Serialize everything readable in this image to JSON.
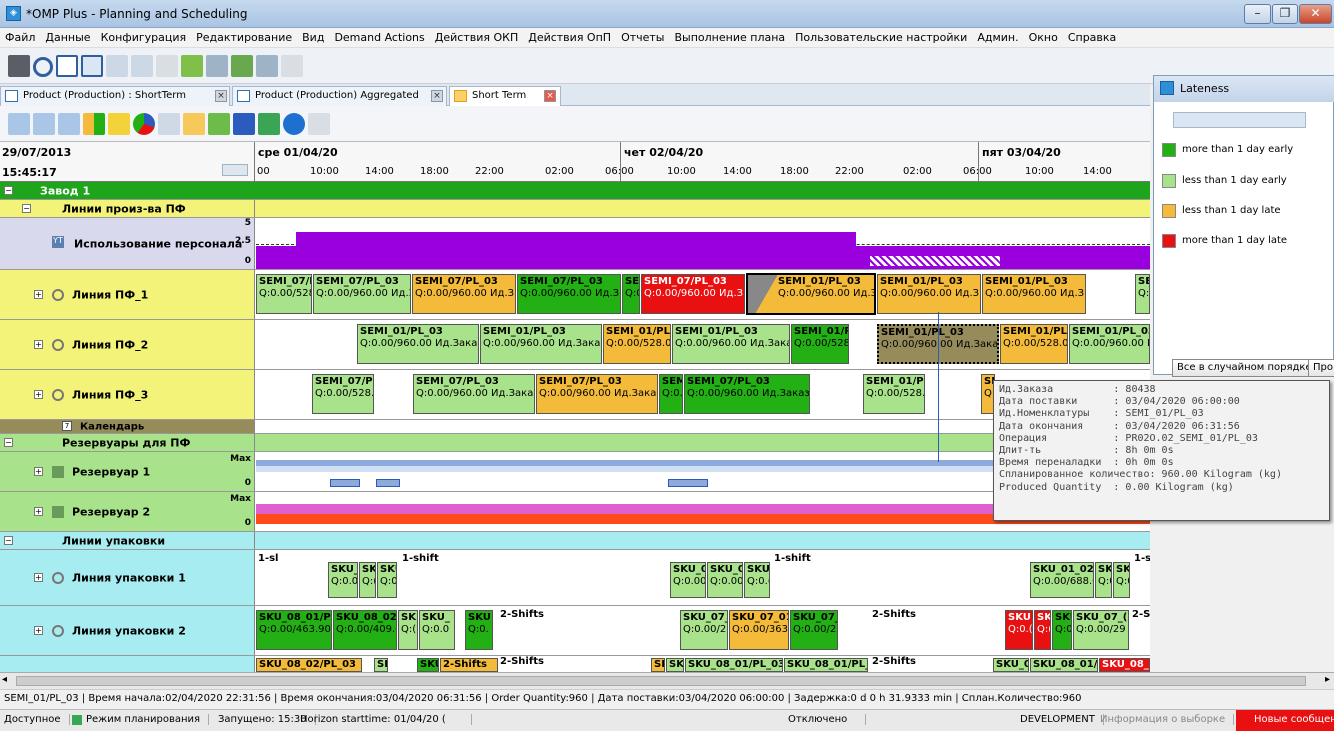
{
  "window": {
    "title": "*OMP Plus - Planning and Scheduling",
    "controls": [
      "–",
      "❐",
      "✕"
    ]
  },
  "menu": [
    "Файл",
    "Данные",
    "Конфигурация",
    "Редактирование",
    "Вид",
    "Demand Actions",
    "Действия ОКП",
    "Действия ОпП",
    "Отчеты",
    "Выполнение плана",
    "Пользовательские настройки",
    "Админ.",
    "Окно",
    "Справка"
  ],
  "tabs": [
    {
      "label": "Product (Production) : ShortTerm"
    },
    {
      "label": "Product (Production) Aggregated"
    },
    {
      "label": "Short Term"
    }
  ],
  "header": {
    "date": "29/07/2013",
    "time": "15:45:17",
    "days": [
      "сре 01/04/20",
      "чет 02/04/20",
      "пят 03/04/20"
    ],
    "hours": [
      "00",
      "10:00",
      "14:00",
      "18:00",
      "22:00",
      "02:00",
      "06:00",
      "10:00",
      "14:00",
      "18:00",
      "22:00",
      "02:00",
      "06:00",
      "10:00",
      "14:00"
    ]
  },
  "rows": {
    "zavod": "Завод 1",
    "lines_group": "Линии произ-ва ПФ",
    "personnel": {
      "label": "Использование персонала",
      "scale_top": "5",
      "scale_mid": "2.5",
      "scale_bot": "0"
    },
    "line1": "Линия ПФ_1",
    "line2": "Линия ПФ_2",
    "line3": "Линия ПФ_3",
    "calendar": "Календарь",
    "reservoirs_group": "Резервуары для ПФ",
    "res1": {
      "label": "Резервуар 1",
      "max": "Max",
      "zero": "0"
    },
    "res2": {
      "label": "Резервуар 2",
      "max": "Max",
      "zero": "0"
    },
    "pack_group": "Линии упаковки",
    "pack1": "Линия упаковки 1",
    "pack2": "Линия упаковки 2"
  },
  "bars": {
    "l1": [
      {
        "t": "SEMI_07/P",
        "q": "Q:0.00/528"
      },
      {
        "t": "SEMI_07/PL_03",
        "q": "Q:0.00/960.00  Ид.З"
      },
      {
        "t": "SEMI_07/PL_03",
        "q": "Q:0.00/960.00  Ид.З"
      },
      {
        "t": "SEMI_07/PL_03",
        "q": "Q:0.00/960.00  Ид.З"
      },
      {
        "t": "SEM",
        "q": "Q:0."
      },
      {
        "t": "SEMI_07/PL_03",
        "q": "Q:0.00/960.00  Ид.З"
      },
      {
        "t": "SEMI_01/PL_03",
        "q": "Q:0.00/960.00  Ид.З"
      },
      {
        "t": "SEMI_01/PL_03",
        "q": "Q:0.00/960.00  Ид.З"
      },
      {
        "t": "SEMI_01/PL_03",
        "q": "Q:0.00/960.00  Ид.З"
      },
      {
        "t": "SE",
        "q": "Q:"
      }
    ],
    "l2": [
      {
        "t": "SEMI_01/PL_03",
        "q": "Q:0.00/960.00  Ид.Заказ"
      },
      {
        "t": "SEMI_01/PL_03",
        "q": "Q:0.00/960.00  Ид.Заказ"
      },
      {
        "t": "SEMI_01/PL",
        "q": "Q:0.00/528.0"
      },
      {
        "t": "SEMI_01/PL_03",
        "q": "Q:0.00/960.00  Ид.Заказ"
      },
      {
        "t": "SEMI_01/PL",
        "q": "Q:0.00/528.0"
      },
      {
        "t": "SEMI_01/PL_03",
        "q": "Q:0.00/960.00  Ид.Заказ"
      },
      {
        "t": "SEMI_01/PL",
        "q": "Q:0.00/528.0"
      },
      {
        "t": "SEMI_01/PL_03",
        "q": "Q:0.00/960.00  Ид"
      }
    ],
    "l3": [
      {
        "t": "SEMI_07/PL",
        "q": "Q:0.00/528.0"
      },
      {
        "t": "SEMI_07/PL_03",
        "q": "Q:0.00/960.00  Ид.Заказ"
      },
      {
        "t": "SEMI_07/PL_03",
        "q": "Q:0.00/960.00  Ид.Заказ"
      },
      {
        "t": "SEMI",
        "q": "Q:0.0"
      },
      {
        "t": "SEMI_07/PL_03",
        "q": "Q:0.00/960.00  Ид.Заказ"
      },
      {
        "t": "SEMI_01/PL",
        "q": "Q:0.00/528.0"
      },
      {
        "t": "SE",
        "q": "Q:"
      }
    ],
    "p1": [
      {
        "t": "1-sl",
        "q": ""
      },
      {
        "t": "SKU_(",
        "q": "Q:0.0("
      },
      {
        "t": "SK",
        "q": "Q:("
      },
      {
        "t": "SKU",
        "q": "Q:0."
      },
      {
        "t": "1-shift",
        "q": ""
      },
      {
        "t": "SKU_0",
        "q": "Q:0.00"
      },
      {
        "t": "SKU_0",
        "q": "Q:0.00"
      },
      {
        "t": "SKU",
        "q": "Q:0.("
      },
      {
        "t": "1-shift",
        "q": ""
      },
      {
        "t": "SKU_01_02/I",
        "q": "Q:0.00/688.0"
      },
      {
        "t": "SKU",
        "q": "Q:0."
      },
      {
        "t": "SKI",
        "q": "Q:0"
      },
      {
        "t": "1-shift",
        "q": ""
      }
    ],
    "p2": [
      {
        "t": "SKU_08_01/PL",
        "q": "Q:0.00/463.90"
      },
      {
        "t": "SKU_08_02/P",
        "q": "Q:0.00/409.6"
      },
      {
        "t": "SK",
        "q": "Q:("
      },
      {
        "t": "SKU_",
        "q": "Q:0.0"
      },
      {
        "t": "SKU",
        "q": "Q:0."
      },
      {
        "t": "2-Shifts",
        "q": ""
      },
      {
        "t": "SKU_07_",
        "q": "Q:0.00/2"
      },
      {
        "t": "SKU_07_01/",
        "q": "Q:0.00/363."
      },
      {
        "t": "SKU_07_",
        "q": "Q:0.00/2"
      },
      {
        "t": "2-Shifts",
        "q": ""
      },
      {
        "t": "SKU",
        "q": "Q:0.("
      },
      {
        "t": "SK",
        "q": "Q:("
      },
      {
        "t": "SKU_",
        "q": "Q:0.0"
      },
      {
        "t": "SKU_07_(",
        "q": "Q:0.00/29"
      },
      {
        "t": "2-Shifts",
        "q": ""
      }
    ],
    "p3": [
      {
        "t": "SKU_08_02/PL_03",
        "q": ""
      },
      {
        "t": "SKI",
        "q": ""
      },
      {
        "t": "SKU_08_01/",
        "q": ""
      },
      {
        "t": "2-Shifts",
        "q": ""
      },
      {
        "t": "SI",
        "q": ""
      },
      {
        "t": "SKI",
        "q": ""
      },
      {
        "t": "SKU_08_01/PL_03",
        "q": ""
      },
      {
        "t": "SKU_08_01/PL_0",
        "q": ""
      },
      {
        "t": "2-Shifts",
        "q": ""
      },
      {
        "t": "SKU_0",
        "q": ""
      },
      {
        "t": "SKU_08_01/P",
        "q": ""
      },
      {
        "t": "SKU_08_01/PL_03",
        "q": ""
      },
      {
        "t": "2-Shifts",
        "q": ""
      }
    ]
  },
  "lateness": {
    "title": "Lateness",
    "items": [
      {
        "label": "more than 1 day early",
        "color": "#22b014"
      },
      {
        "label": "less than 1 day early",
        "color": "#a8e28a"
      },
      {
        "label": "less than 1 day late",
        "color": "#f4bb3a"
      },
      {
        "label": "more than 1 day late",
        "color": "#e81010"
      }
    ],
    "btn_random": "Все в случайном порядке",
    "btn_more": "Про"
  },
  "tooltip": [
    "Ид.Заказа          : 80438",
    "Дата поставки      : 03/04/2020 06:00:00",
    "Ид.Номенклатуры    : SEMI_01/PL_03",
    "Дата окончания     : 03/04/2020 06:31:56",
    "Операция           : PR02O.02_SEMI_01/PL_03",
    "Длит-ть            : 8h 0m 0s",
    "Время переналадки  : 0h 0m 0s",
    "Спланированное количество: 960.00 Kilogram (kg)",
    "Produced Quantity  : 0.00 Kilogram (kg)"
  ],
  "status_info": "SEMI_01/PL_03 | Время начала:02/04/2020 22:31:56 | Время окончания:03/04/2020 06:31:56 | Order Quantity:960 | Дата поставки:03/04/2020 06:00:00 | Задержка:0 d 0 h 31.9333 min  | Сплан.Количество:960",
  "statusbar": {
    "available": "Доступное",
    "mode": "Режим планирования",
    "started": "Запущено: 15:30",
    "horizon": "Horizon starttime: 01/04/20 (",
    "disabled": "Отключено",
    "env": "DEVELOPMENT",
    "selection": "Информация о выборке",
    "messages": "Новые сообщения"
  }
}
